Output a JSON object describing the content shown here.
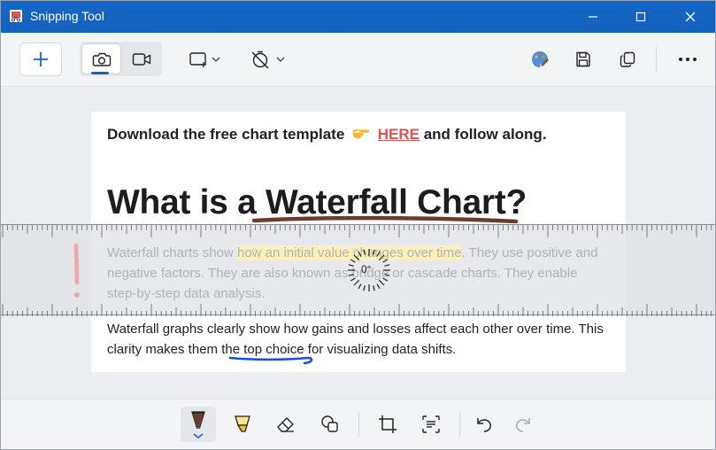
{
  "window": {
    "title": "Snipping Tool"
  },
  "toolbar": {
    "new_label": "New",
    "mode_photo": "Snipping mode photo",
    "mode_video": "Video mode",
    "shape_label": "Snip shape",
    "delay_label": "Delay",
    "paint_label": "Open with Paint",
    "save_label": "Save",
    "copy_label": "Copy",
    "more_label": "See more"
  },
  "content": {
    "line1_prefix": "Download the free chart template",
    "line1_link": "HERE",
    "line1_suffix": "and follow along.",
    "heading_prefix": "What is a ",
    "heading_highlight": "Waterfall Chart?",
    "para1_line1_a": "Waterfall charts show ",
    "para1_line1_hl": "how an initial value changes over time",
    "para1_line1_b": ". They use positive and",
    "para1_line2": "negative factors. They are also known as bridge or cascade charts. They enable",
    "para1_line3": "step-by-step data analysis.",
    "para2_line1": "Waterfall graphs clearly show how gains and losses affect each other over time. This",
    "para2_line2_a": "clarity makes them the ",
    "para2_line2_b": "top choice",
    "para2_line2_c": " for visualizing data shifts."
  },
  "ruler": {
    "angle": "0°"
  },
  "colors": {
    "titlebar": "#1565c0",
    "ink_brown": "#6b3b2e",
    "ink_blue": "#1550d6",
    "ink_pink": "#f0a7a7",
    "highlighter": "#f7e58a",
    "link": "#d9534f"
  },
  "bottom_tools": [
    "ballpoint-pen",
    "highlighter",
    "eraser",
    "shapes",
    "crop",
    "text-actions",
    "undo",
    "redo"
  ]
}
